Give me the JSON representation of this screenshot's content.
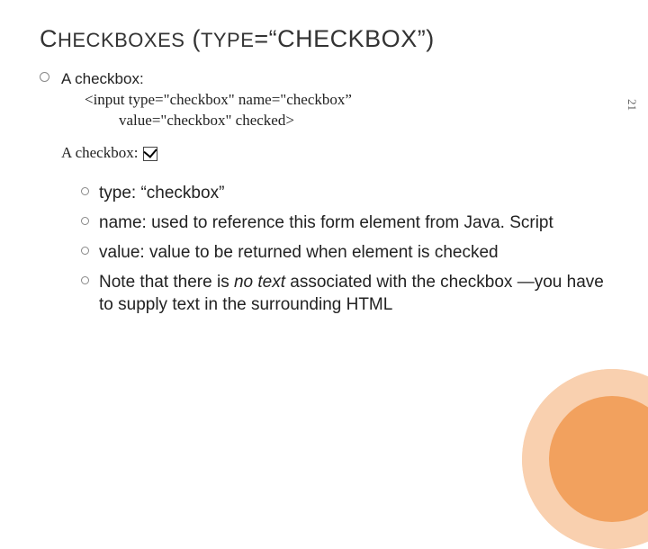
{
  "title_parts": {
    "a": "C",
    "b": "HECKBOXES",
    "c": " (",
    "d": "TYPE",
    "e": "=“CHECKBOX”)"
  },
  "intro_label": "A checkbox:",
  "code_lines": {
    "l1": "<input type=\"checkbox\" name=\"checkbox”",
    "l2": "value=\"checkbox\" checked>"
  },
  "example_label": "A checkbox:",
  "attrs": [
    {
      "text": "type: “checkbox”"
    },
    {
      "text": "name: used to reference this form element from Java. Script"
    },
    {
      "text": "value: value to be returned when element is checked"
    },
    {
      "text_pre": "Note that there is ",
      "text_em": "no text",
      "text_post": " associated with the checkbox —you have to supply text in the surrounding HTML"
    }
  ],
  "page_number": "21"
}
